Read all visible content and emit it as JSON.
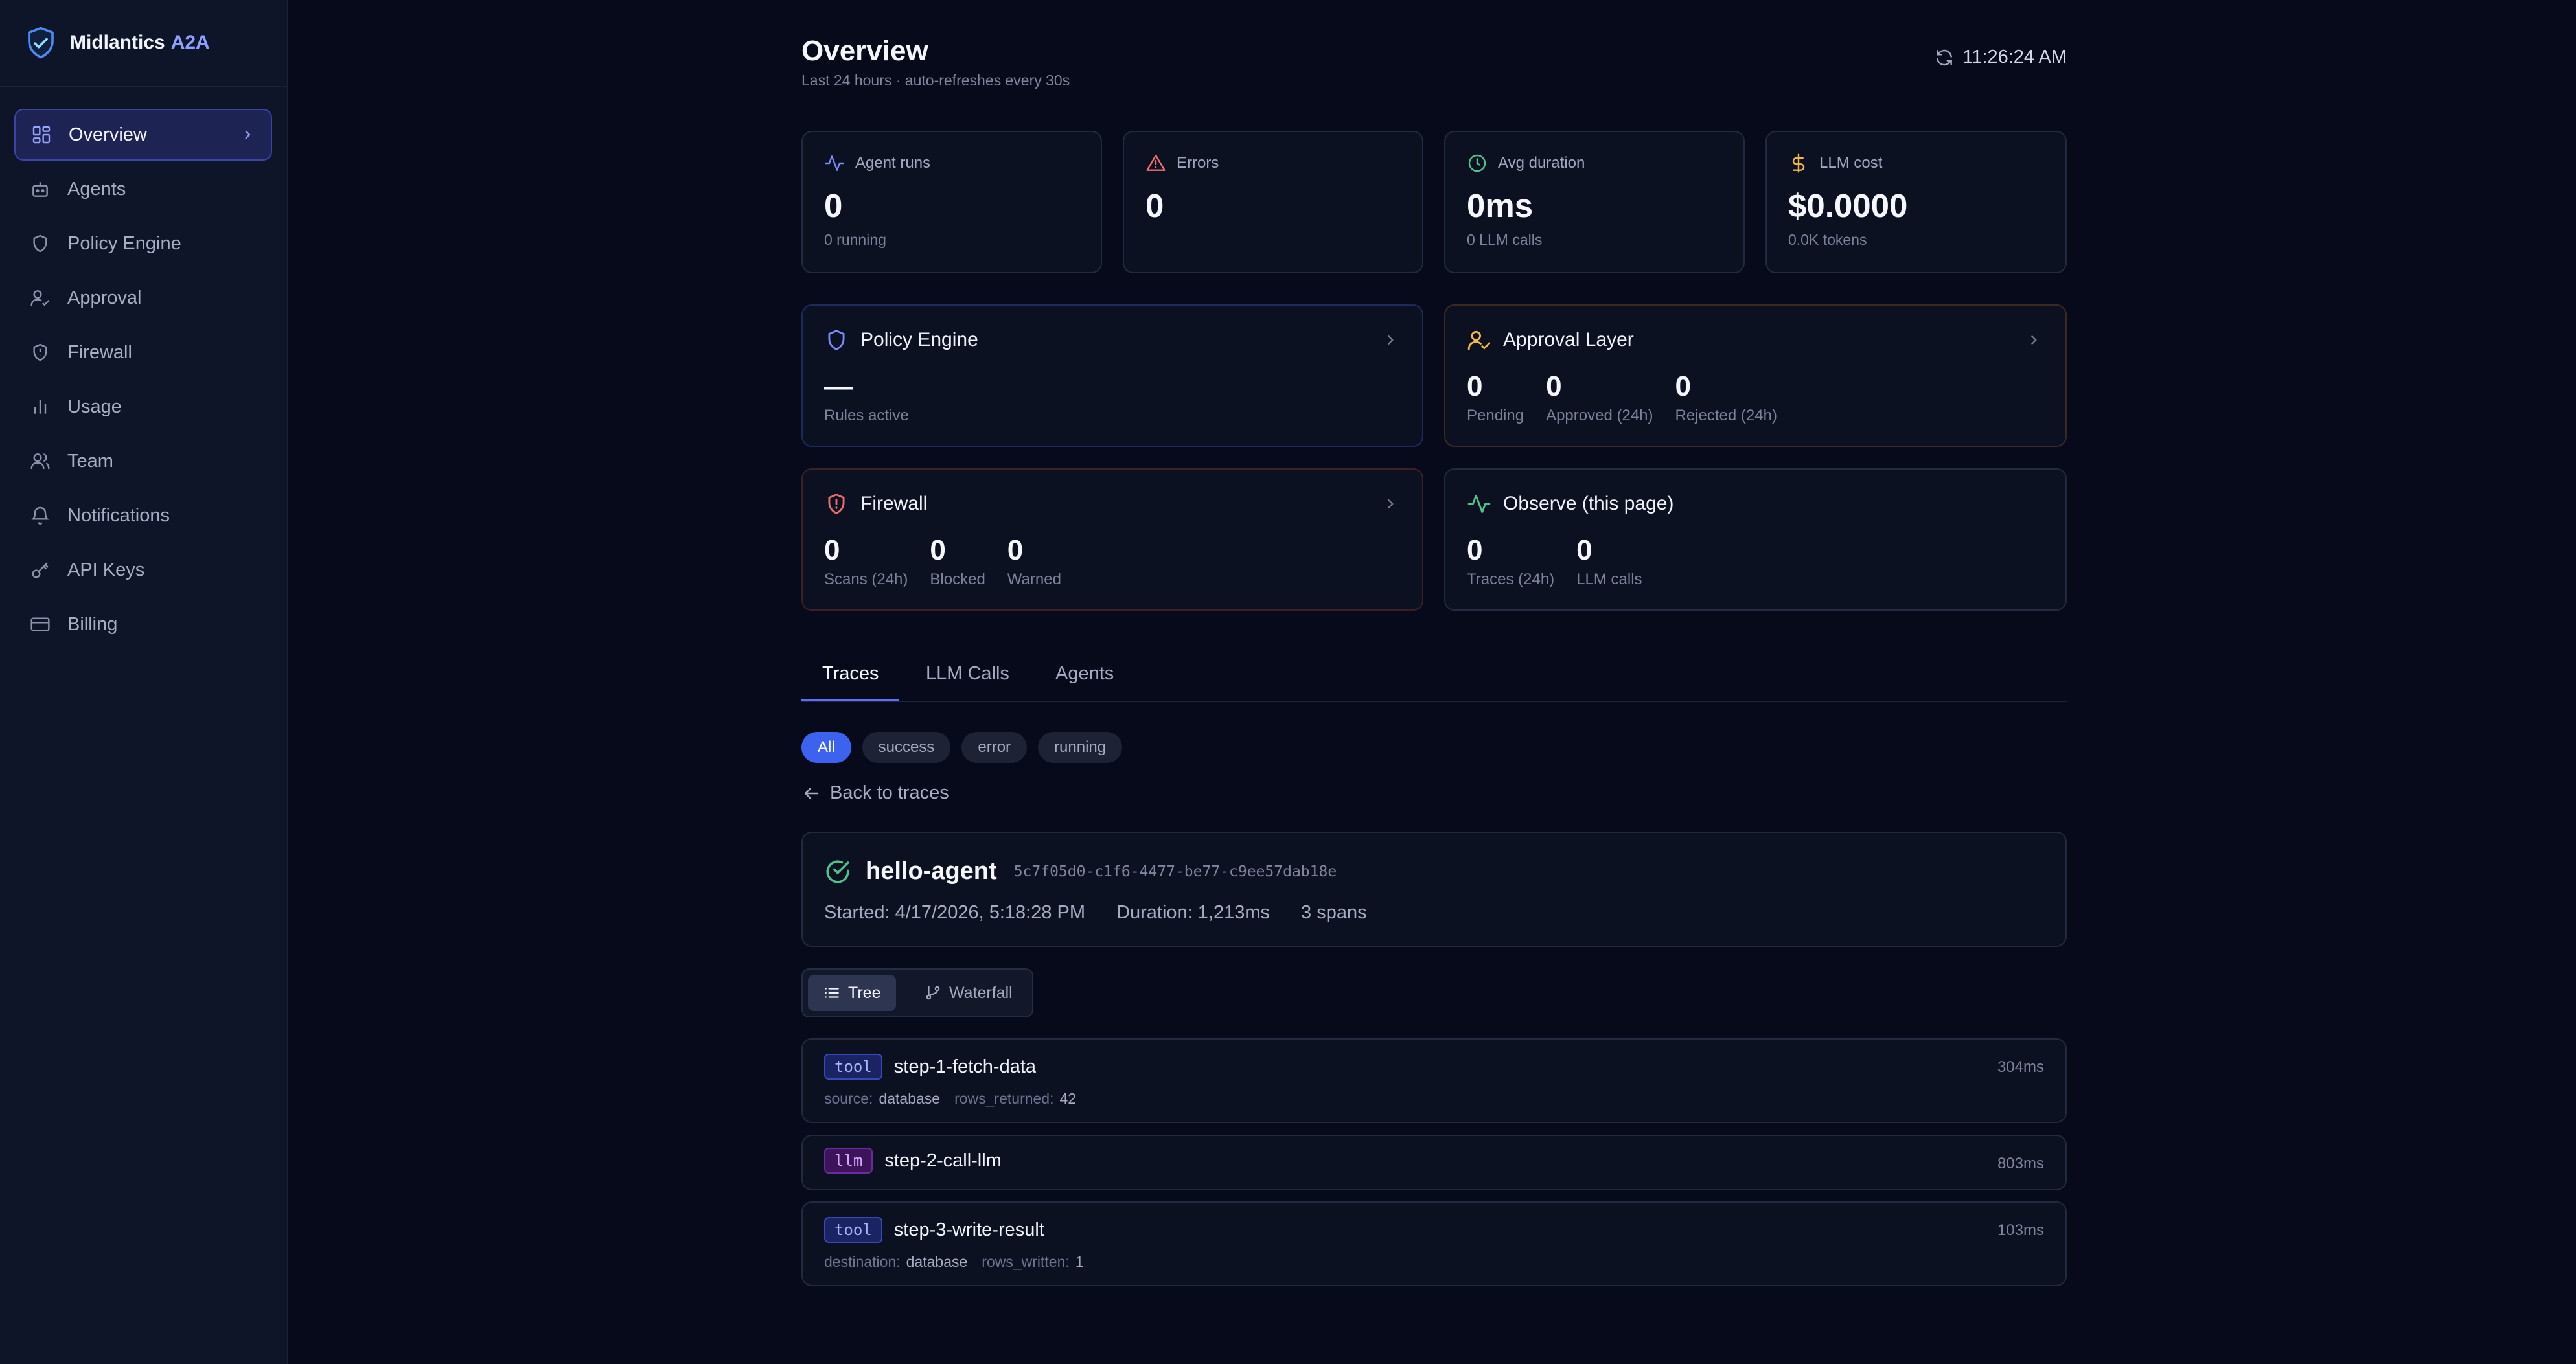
{
  "brand": {
    "name": "Midlantics",
    "accent": "A2A"
  },
  "sidebar": {
    "items": [
      {
        "label": "Overview",
        "icon": "grid-icon",
        "active": true
      },
      {
        "label": "Agents",
        "icon": "bot-icon"
      },
      {
        "label": "Policy Engine",
        "icon": "shield-icon"
      },
      {
        "label": "Approval",
        "icon": "user-check-icon"
      },
      {
        "label": "Firewall",
        "icon": "shield-alert-icon"
      },
      {
        "label": "Usage",
        "icon": "bar-chart-icon"
      },
      {
        "label": "Team",
        "icon": "users-icon"
      },
      {
        "label": "Notifications",
        "icon": "bell-icon"
      },
      {
        "label": "API Keys",
        "icon": "key-icon"
      },
      {
        "label": "Billing",
        "icon": "credit-card-icon"
      }
    ]
  },
  "header": {
    "title": "Overview",
    "subtitle": "Last 24 hours · auto-refreshes every 30s",
    "time": "11:26:24 AM"
  },
  "stats": [
    {
      "label": "Agent runs",
      "value": "0",
      "sub": "0 running",
      "icon": "activity-icon",
      "color": "#7b8cff"
    },
    {
      "label": "Errors",
      "value": "0",
      "sub": "",
      "icon": "alert-triangle-icon",
      "color": "#f26d6d"
    },
    {
      "label": "Avg duration",
      "value": "0ms",
      "sub": "0 LLM calls",
      "icon": "clock-icon",
      "color": "#4fc38a"
    },
    {
      "label": "LLM cost",
      "value": "$0.0000",
      "sub": "0.0K tokens",
      "icon": "dollar-icon",
      "color": "#f2b84b"
    }
  ],
  "features": {
    "policy": {
      "title": "Policy Engine",
      "value": "—",
      "label": "Rules active"
    },
    "approval": {
      "title": "Approval Layer",
      "metrics": [
        {
          "value": "0",
          "label": "Pending"
        },
        {
          "value": "0",
          "label": "Approved (24h)"
        },
        {
          "value": "0",
          "label": "Rejected (24h)"
        }
      ]
    },
    "firewall": {
      "title": "Firewall",
      "metrics": [
        {
          "value": "0",
          "label": "Scans (24h)"
        },
        {
          "value": "0",
          "label": "Blocked"
        },
        {
          "value": "0",
          "label": "Warned"
        }
      ]
    },
    "observe": {
      "title": "Observe (this page)",
      "metrics": [
        {
          "value": "0",
          "label": "Traces (24h)"
        },
        {
          "value": "0",
          "label": "LLM calls"
        }
      ]
    }
  },
  "tabs": [
    "Traces",
    "LLM Calls",
    "Agents"
  ],
  "active_tab": "Traces",
  "filters": [
    "All",
    "success",
    "error",
    "running"
  ],
  "active_filter": "All",
  "back_label": "Back to traces",
  "trace": {
    "name": "hello-agent",
    "id": "5c7f05d0-c1f6-4477-be77-c9ee57dab18e",
    "started": "Started: 4/17/2026, 5:18:28 PM",
    "duration": "Duration: 1,213ms",
    "spans": "3 spans",
    "status": "success"
  },
  "view_toggle": {
    "tree": "Tree",
    "waterfall": "Waterfall",
    "active": "Tree"
  },
  "spans": [
    {
      "type": "tool",
      "name": "step-1-fetch-data",
      "duration": "304ms",
      "attrs": [
        {
          "key": "source:",
          "value": "database"
        },
        {
          "key": "rows_returned:",
          "value": "42"
        }
      ]
    },
    {
      "type": "llm",
      "name": "step-2-call-llm",
      "duration": "803ms",
      "attrs": []
    },
    {
      "type": "tool",
      "name": "step-3-write-result",
      "duration": "103ms",
      "attrs": [
        {
          "key": "destination:",
          "value": "database"
        },
        {
          "key": "rows_written:",
          "value": "1"
        }
      ]
    }
  ],
  "colors": {
    "accent": "#5f6dff",
    "background": "#070a1a",
    "sidebar": "#0f1528",
    "success": "#4fc38a",
    "error": "#f26d6d",
    "warning": "#f2b84b"
  }
}
